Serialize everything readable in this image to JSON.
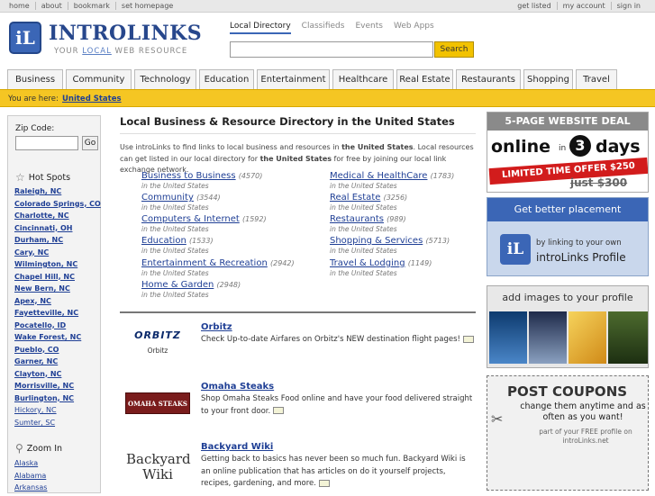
{
  "topbar": {
    "left": [
      "home",
      "about",
      "bookmark",
      "set homepage"
    ],
    "right": [
      "get listed",
      "my account",
      "sign in"
    ]
  },
  "logo": {
    "mark": "iL",
    "name": "INTROLINKS",
    "tag_pre": "YOUR ",
    "tag_local": "LOCAL",
    "tag_post": " WEB RESOURCE"
  },
  "nav": [
    "Local Directory",
    "Classifieds",
    "Events",
    "Web Apps"
  ],
  "search": {
    "button": "Search",
    "value": ""
  },
  "categories": [
    "Business",
    "Community",
    "Technology",
    "Education",
    "Entertainment",
    "Healthcare",
    "Real Estate",
    "Restaurants",
    "Shopping",
    "Travel"
  ],
  "breadcrumb": {
    "label": "You are here:",
    "location": "United States"
  },
  "sidebar": {
    "zip_label": "Zip Code:",
    "zip_go": "Go",
    "hot_title": "Hot Spots",
    "hot_spots": [
      "Raleigh, NC",
      "Colorado Springs, CO",
      "Charlotte, NC",
      "Cincinnati, OH",
      "Durham, NC",
      "Cary, NC",
      "Wilmington, NC",
      "Chapel Hill, NC",
      "New Bern, NC",
      "Apex, NC",
      "Fayetteville, NC",
      "Pocatello, ID",
      "Wake Forest, NC",
      "Pueblo, CO",
      "Garner, NC",
      "Clayton, NC",
      "Morrisville, NC",
      "Burlington, NC",
      "Hickory, NC",
      "Sumter, SC"
    ],
    "zoom_title": "Zoom In",
    "zoom": [
      "Alaska",
      "Alabama",
      "Arkansas"
    ]
  },
  "main": {
    "title": "Local Business & Resource Directory in the United States",
    "intro_1": "Use introLinks to find links to local business and resources in ",
    "intro_b1": "the United States",
    "intro_2": ". Local resources can get listed in our local directory for ",
    "intro_b2": "the United States",
    "intro_3": " for free by joining our local link exchange network.",
    "dir_left": [
      {
        "name": "Business to Business",
        "count": "(4570)",
        "loc": "in the United States"
      },
      {
        "name": "Community",
        "count": "(3544)",
        "loc": "in the United States"
      },
      {
        "name": "Computers & Internet",
        "count": "(1592)",
        "loc": "in the United States"
      },
      {
        "name": "Education",
        "count": "(1533)",
        "loc": "in the United States"
      },
      {
        "name": "Entertainment & Recreation",
        "count": "(2942)",
        "loc": "in the United States"
      },
      {
        "name": "Home & Garden",
        "count": "(2948)",
        "loc": "in the United States"
      }
    ],
    "dir_right": [
      {
        "name": "Medical & HealthCare",
        "count": "(1783)",
        "loc": "in the United States"
      },
      {
        "name": "Real Estate",
        "count": "(3256)",
        "loc": "in the United States"
      },
      {
        "name": "Restaurants",
        "count": "(989)",
        "loc": "in the United States"
      },
      {
        "name": "Shopping & Services",
        "count": "(5713)",
        "loc": "in the United States"
      },
      {
        "name": "Travel & Lodging",
        "count": "(1149)",
        "loc": "in the United States"
      }
    ],
    "ads": [
      {
        "title": "Orbitz",
        "logo": "ORBITZ",
        "logo_sub": "Orbitz",
        "desc": "Check Up-to-date Airfares on Orbitz's NEW destination flight pages!"
      },
      {
        "title": "Omaha Steaks",
        "logo": "OMAHA STEAKS",
        "logo_sub": "",
        "desc": "Shop Omaha Steaks Food online and have your food delivered straight to your front door."
      },
      {
        "title": "Backyard Wiki",
        "logo": "Backyard Wiki",
        "logo_sub": "",
        "desc": "Getting back to basics has never been so much fun. Backyard Wiki is an online publication that has articles on do it yourself projects, recipes, gardening, and more."
      }
    ]
  },
  "right": {
    "b1_head": "5-PAGE WEBSITE DEAL",
    "b1_online": "online",
    "b1_in": "in",
    "b1_num": "3",
    "b1_days": "days",
    "b1_offer": "LIMITED TIME OFFER $250",
    "b1_strike": "just $300",
    "b2_head": "Get better placement",
    "b2_text": "by linking to your own",
    "b2_brand": "introLinks Profile",
    "b2_mark": "iL",
    "b3_head": "add images to your profile",
    "b4_head": "POST COUPONS",
    "b4_text": "change them anytime and as often as you want!",
    "b4_small": "part of your FREE profile on introLinks.net"
  }
}
